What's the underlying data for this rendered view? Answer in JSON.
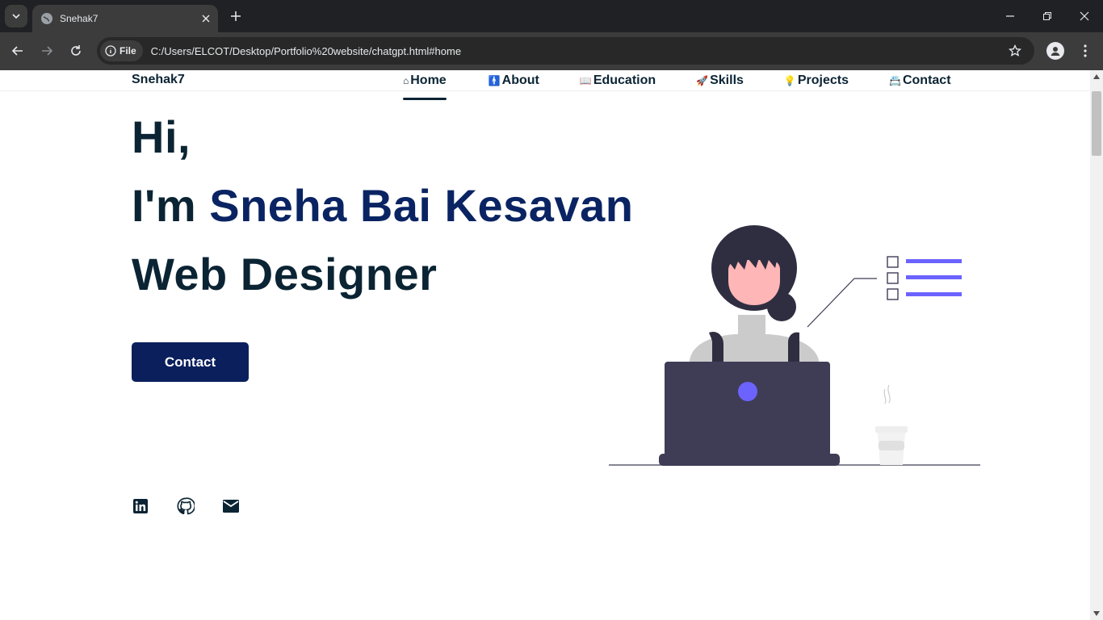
{
  "browser": {
    "tab_title": "Snehak7",
    "site_chip_label": "File",
    "url": "C:/Users/ELCOT/Desktop/Portfolio%20website/chatgpt.html#home"
  },
  "header": {
    "logo": "Snehak7",
    "nav": [
      {
        "icon": "⌂",
        "label": "Home",
        "active": true
      },
      {
        "icon": "🚹",
        "label": "About"
      },
      {
        "icon": "📖",
        "label": "Education"
      },
      {
        "icon": "🚀",
        "label": "Skills"
      },
      {
        "icon": "💡",
        "label": "Projects"
      },
      {
        "icon": "📇",
        "label": "Contact"
      }
    ]
  },
  "hero": {
    "line1": "Hi,",
    "line2_prefix": "I'm ",
    "line2_name": "Sneha Bai Kesavan",
    "line3": "Web Designer",
    "button_label": "Contact"
  },
  "social": [
    "linkedin-icon",
    "github-icon",
    "mail-icon"
  ],
  "colors": {
    "primary_text": "#0b2434",
    "name_accent": "#0a2463",
    "button_bg": "#0a1f5c",
    "illustration_accent": "#6c63ff",
    "illustration_dark": "#3f3d56"
  }
}
